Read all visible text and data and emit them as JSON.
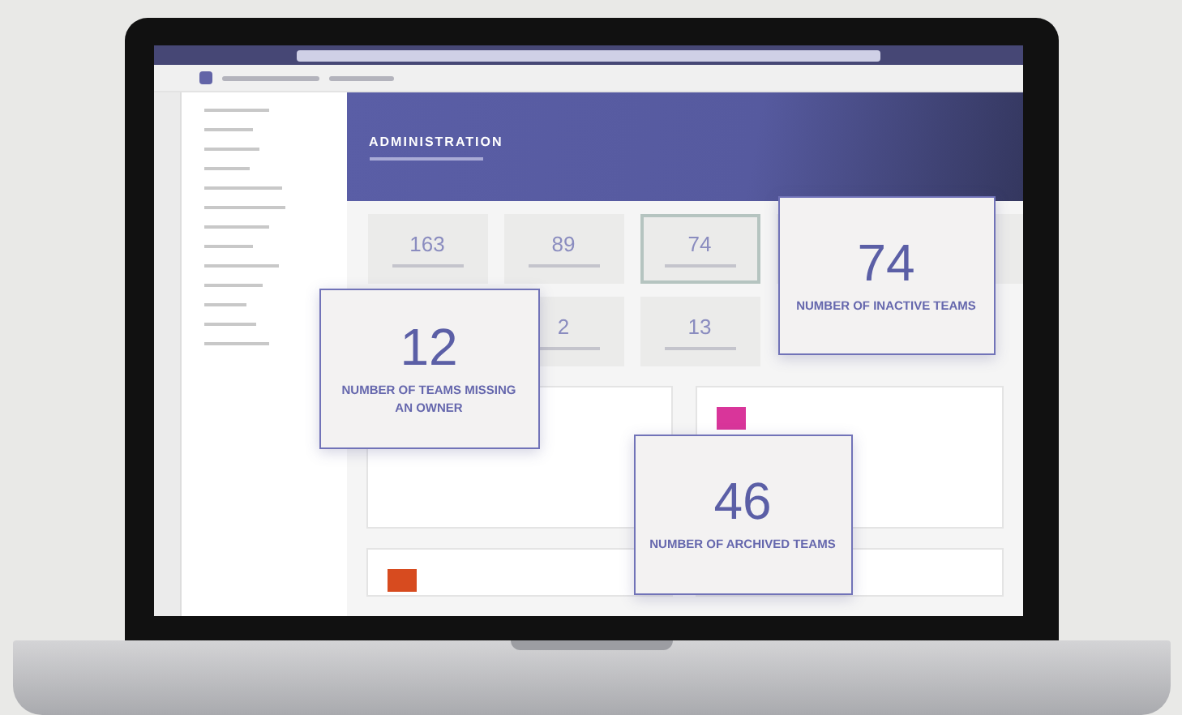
{
  "screen": {
    "banner_title": "ADMINISTRATION",
    "stats": [
      {
        "value": "163",
        "selected": false
      },
      {
        "value": "89",
        "selected": false
      },
      {
        "value": "74",
        "selected": true
      },
      {
        "value": "2",
        "selected": false
      },
      {
        "value": "13",
        "selected": false
      }
    ]
  },
  "callouts": [
    {
      "value": "12",
      "label": "NUMBER OF TEAMS MISSING AN OWNER"
    },
    {
      "value": "74",
      "label": "NUMBER OF INACTIVE TEAMS"
    },
    {
      "value": "46",
      "label": "NUMBER OF ARCHIVED TEAMS"
    }
  ]
}
